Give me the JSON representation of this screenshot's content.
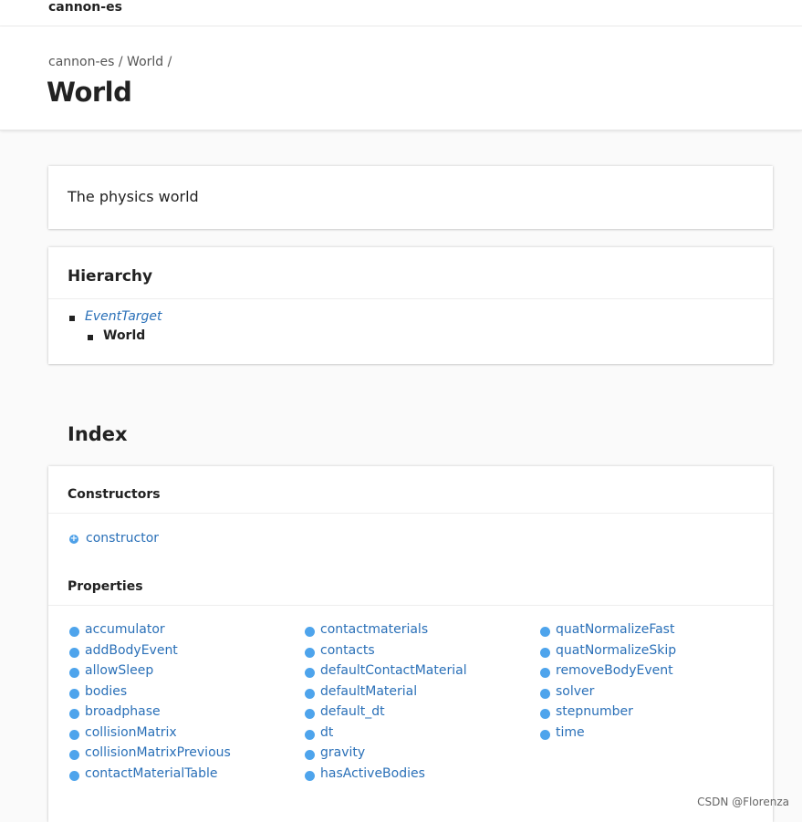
{
  "site": {
    "title": "cannon-es"
  },
  "breadcrumb": {
    "items": [
      "cannon-es",
      "World"
    ],
    "separator": "/"
  },
  "page": {
    "title": "World"
  },
  "description": "The physics world",
  "hierarchy": {
    "heading": "Hierarchy",
    "parent": "EventTarget",
    "current": "World"
  },
  "index": {
    "heading": "Index",
    "constructors": {
      "heading": "Constructors",
      "items": [
        "constructor"
      ]
    },
    "properties": {
      "heading": "Properties",
      "columns": [
        [
          "accumulator",
          "addBodyEvent",
          "allowSleep",
          "bodies",
          "broadphase",
          "collisionMatrix",
          "collisionMatrixPrevious",
          "contactMaterialTable"
        ],
        [
          "contactmaterials",
          "contacts",
          "defaultContactMaterial",
          "defaultMaterial",
          "default_dt",
          "dt",
          "gravity",
          "hasActiveBodies"
        ],
        [
          "quatNormalizeFast",
          "quatNormalizeSkip",
          "removeBodyEvent",
          "solver",
          "stepnumber",
          "time"
        ]
      ]
    }
  },
  "watermark": "CSDN @Florenza",
  "colors": {
    "link": "#2a70b8",
    "property_dot": "#4ea4ec",
    "background": "#fafafa"
  },
  "icons": {
    "constructor": "constructor-icon",
    "property": "property-icon",
    "bullet": "square-bullet-icon"
  }
}
